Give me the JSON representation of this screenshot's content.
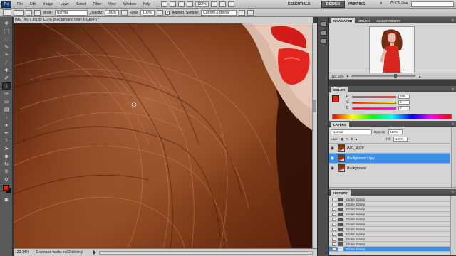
{
  "app": {
    "logo": "Ps",
    "menus": [
      "File",
      "Edit",
      "Image",
      "Layer",
      "Select",
      "Filter",
      "View",
      "Window",
      "Help"
    ],
    "zoom_display": "122%",
    "workspaces": [
      "ESSENTIALS",
      "DESIGN",
      "PAINTING"
    ],
    "workspace_more": "»",
    "cs_live": "CS Live"
  },
  "options_bar": {
    "mode_label": "Mode:",
    "mode_value": "Normal",
    "opacity_label": "Opacity:",
    "opacity_value": "100%",
    "flow_label": "Flow:",
    "flow_value": "100%",
    "aligned_label": "Aligned",
    "sample_label": "Sample:",
    "sample_value": "Current & Below"
  },
  "document": {
    "tab_title": "IMG_4970.jpg @ 122% (Background copy, RGB/8*) *",
    "status_zoom": "122.14%",
    "status_info": "Exposure works in 32-bit only"
  },
  "panels": {
    "navigator": {
      "tabs": [
        "NAVIGATOR",
        "BRUSH",
        "ADJUSTMENTS"
      ],
      "zoom": "122.14%"
    },
    "color": {
      "tabs": [
        "COLOR"
      ],
      "channels": [
        {
          "label": "R",
          "value": "255"
        },
        {
          "label": "G",
          "value": "0"
        },
        {
          "label": "B",
          "value": "0"
        }
      ],
      "foreground": "#e81c0a",
      "background": "#111111"
    },
    "layers": {
      "tabs": [
        "LAYERS"
      ],
      "blend_mode": "Normal",
      "opacity_label": "Opacity:",
      "opacity_value": "100%",
      "lock_label": "Lock:",
      "fill_label": "Fill:",
      "fill_value": "100%",
      "items": [
        {
          "name": "IMG_4970",
          "selected": false
        },
        {
          "name": "Background copy",
          "selected": true
        },
        {
          "name": "Background",
          "selected": false
        }
      ]
    },
    "history": {
      "tabs": [
        "HISTORY"
      ],
      "items": [
        "Clone Stamp",
        "Clone Stamp",
        "Clone Stamp",
        "Clone Stamp",
        "Clone Stamp",
        "Clone Stamp",
        "Clone Stamp",
        "Clone Stamp",
        "Clone Stamp",
        "Clone Stamp",
        "Clone Stamp"
      ],
      "selected_index": 10
    }
  },
  "colors": {
    "selection": "#3a8ee6",
    "panel_bg": "#d4d4d4",
    "chrome_dark": "#3c3c3c"
  }
}
